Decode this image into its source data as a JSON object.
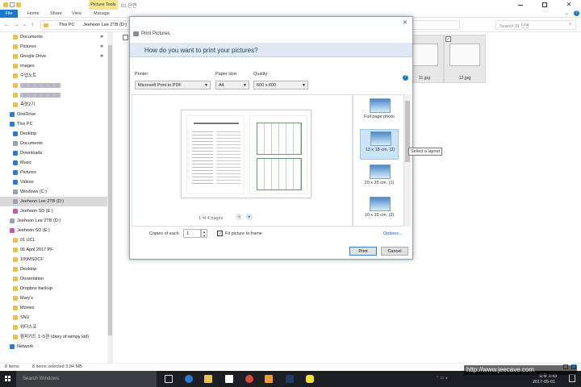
{
  "explorer": {
    "title_path": "01 단면",
    "contextual_tab": "Picture Tools",
    "tabs": [
      "File",
      "Home",
      "Share",
      "View",
      "Manage"
    ],
    "breadcrumb": [
      "This PC",
      "Jeehoon Lee 2TB (D:)"
    ],
    "search_placeholder": "Search 01 단면",
    "nav_items": [
      {
        "label": "Documents",
        "type": "fold",
        "pinned": true
      },
      {
        "label": "Pictures",
        "type": "fold",
        "pinned": true
      },
      {
        "label": "Google Drive",
        "type": "fold",
        "pinned": true
      },
      {
        "label": "images",
        "type": "fold"
      },
      {
        "label": "수업노트",
        "type": "fold"
      },
      {
        "label": "",
        "type": "fold"
      },
      {
        "label": "",
        "type": "fold"
      },
      {
        "label": "측량2기",
        "type": "fold"
      },
      {
        "label": "OneDrive",
        "type": "blue"
      },
      {
        "label": "This PC",
        "type": "blue"
      },
      {
        "label": "Desktop",
        "type": "blue"
      },
      {
        "label": "Documents",
        "type": "gray"
      },
      {
        "label": "Downloads",
        "type": "blue"
      },
      {
        "label": "Music",
        "type": "blue"
      },
      {
        "label": "Pictures",
        "type": "blue"
      },
      {
        "label": "Videos",
        "type": "blue"
      },
      {
        "label": "Windows (C:)",
        "type": "gray"
      },
      {
        "label": "Jeehoon Lee 2TB (D:)",
        "type": "gray",
        "selected": true
      },
      {
        "label": "Jeehoon SD (E:)",
        "type": "pink"
      },
      {
        "label": "Jeehoon Lee 2TB (D:)",
        "type": "gray"
      },
      {
        "label": "Jeehoon SD (E:)",
        "type": "pink"
      },
      {
        "label": "01 UCL",
        "type": "fold"
      },
      {
        "label": "06 April 2017 PF",
        "type": "fold"
      },
      {
        "label": "100MSDCF",
        "type": "fold"
      },
      {
        "label": "Desktop",
        "type": "fold"
      },
      {
        "label": "Dissertation",
        "type": "fold"
      },
      {
        "label": "Dropbox backup",
        "type": "fold"
      },
      {
        "label": "Mary's",
        "type": "fold"
      },
      {
        "label": "Movies",
        "type": "fold"
      },
      {
        "label": "SNU",
        "type": "fold"
      },
      {
        "label": "위더스코",
        "type": "fold"
      },
      {
        "label": "윔피키드 1~5권 (diary of wimpy kid)",
        "type": "fold"
      },
      {
        "label": "Network",
        "type": "blue"
      }
    ],
    "files": [
      {
        "name": "11.jpg"
      },
      {
        "name": "12.jpg"
      }
    ],
    "status": {
      "count": "8 items",
      "selected": "8 items selected  3.84 MB"
    }
  },
  "dialog": {
    "title": "Print Pictures",
    "question": "How do you want to print your pictures?",
    "printer_label": "Printer:",
    "printer_value": "Microsoft Print to PDF",
    "paper_label": "Paper size:",
    "paper_value": "A4",
    "quality_label": "Quality:",
    "quality_value": "600 x 600",
    "page_indicator": "1 of 4 pages",
    "layouts": [
      {
        "label": "Full page photo",
        "selected": false
      },
      {
        "label": "13 x 18 cm. (2)",
        "selected": true
      },
      {
        "label": "20 x 25 cm. (1)",
        "selected": false
      },
      {
        "label": "10 x 15 cm. (2)",
        "selected": false
      }
    ],
    "copies_label": "Copies of each",
    "copies_value": "1",
    "fit_label": "Fit picture to frame",
    "fit_checked": true,
    "options_link": "Options...",
    "print_button": "Print",
    "cancel_button": "Cancel",
    "tooltip": "Select a layout"
  },
  "taskbar": {
    "search_placeholder": "Search Windows",
    "time": "오후 3:43",
    "date": "2017-05-01"
  },
  "watermark": "http://www.jeecave.com"
}
